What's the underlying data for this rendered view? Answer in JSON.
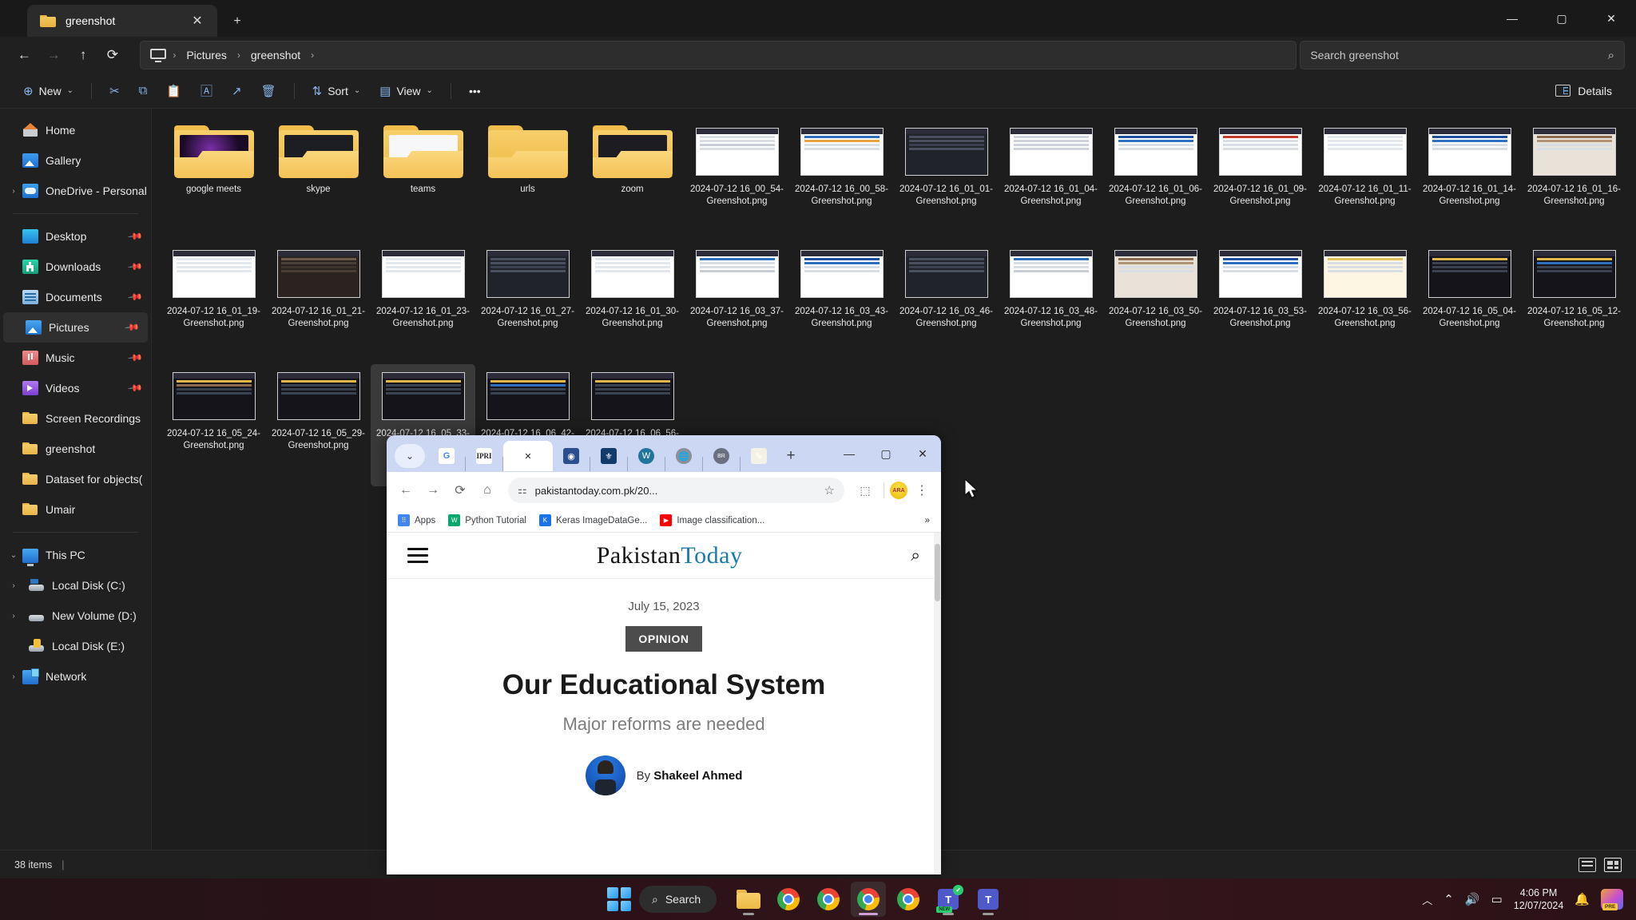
{
  "explorer": {
    "tab": {
      "title": "greenshot",
      "close_label": "✕",
      "new_tab_label": "+"
    },
    "window_controls": {
      "minimize": "—",
      "maximize": "▢",
      "close": "✕"
    },
    "nav": {
      "back": "←",
      "forward": "→",
      "up": "↑",
      "refresh": "⟳"
    },
    "breadcrumb": {
      "items": [
        "Pictures",
        "greenshot"
      ],
      "separator": "›"
    },
    "search": {
      "placeholder": "Search greenshot",
      "icon": "search-icon"
    },
    "commandbar": {
      "new_label": "New",
      "cut_label": "✂",
      "copy_label": "⧉",
      "paste_label": "📋",
      "rename_label": "🄰",
      "share_label": "↗",
      "delete_label": "🗑",
      "sort_label": "Sort",
      "view_label": "View",
      "more_label": "•••",
      "details_label": "Details",
      "chevron": "⌄"
    },
    "sidebar": [
      {
        "label": "Home",
        "icon": "home-icon",
        "expander": "",
        "pinned": false,
        "selected": false,
        "icon_class": "ic-home"
      },
      {
        "label": "Gallery",
        "icon": "gallery-icon",
        "expander": "",
        "pinned": false,
        "selected": false,
        "icon_class": "ic-gallery"
      },
      {
        "label": "OneDrive - Personal",
        "icon": "onedrive-icon",
        "expander": "›",
        "pinned": false,
        "selected": false,
        "icon_class": "ic-onedrive"
      },
      {
        "separator": true
      },
      {
        "label": "Desktop",
        "icon": "desktop-icon",
        "expander": "",
        "pinned": true,
        "selected": false,
        "icon_class": "ic-desktop"
      },
      {
        "label": "Downloads",
        "icon": "downloads-icon",
        "expander": "",
        "pinned": true,
        "selected": false,
        "icon_class": "ic-downloads"
      },
      {
        "label": "Documents",
        "icon": "documents-icon",
        "expander": "",
        "pinned": true,
        "selected": false,
        "icon_class": "ic-documents"
      },
      {
        "label": "Pictures",
        "icon": "pictures-icon",
        "expander": "",
        "pinned": true,
        "selected": true,
        "icon_class": "ic-pictures"
      },
      {
        "label": "Music",
        "icon": "music-icon",
        "expander": "",
        "pinned": true,
        "selected": false,
        "icon_class": "ic-music"
      },
      {
        "label": "Videos",
        "icon": "videos-icon",
        "expander": "",
        "pinned": true,
        "selected": false,
        "icon_class": "ic-videos"
      },
      {
        "label": "Screen Recordings",
        "icon": "folder-icon",
        "expander": "",
        "pinned": false,
        "selected": false,
        "icon_class": "ic-folder"
      },
      {
        "label": "greenshot",
        "icon": "folder-icon",
        "expander": "",
        "pinned": false,
        "selected": false,
        "icon_class": "ic-folder"
      },
      {
        "label": "Dataset for objects(",
        "icon": "folder-icon",
        "expander": "",
        "pinned": false,
        "selected": false,
        "icon_class": "ic-folder"
      },
      {
        "label": "Umair",
        "icon": "folder-icon",
        "expander": "",
        "pinned": false,
        "selected": false,
        "icon_class": "ic-folder"
      },
      {
        "separator": true
      },
      {
        "label": "This PC",
        "icon": "this-pc-icon",
        "expander": "⌄",
        "pinned": false,
        "selected": false,
        "icon_class": "ic-thispc"
      },
      {
        "label": "Local Disk (C:)",
        "icon": "disk-icon",
        "expander": "›",
        "indent": true,
        "pinned": false,
        "selected": false,
        "icon_class": "ic-disk"
      },
      {
        "label": "New Volume (D:)",
        "icon": "disk-icon",
        "expander": "›",
        "indent": true,
        "pinned": false,
        "selected": false,
        "icon_class": "ic-disk2"
      },
      {
        "label": "Local Disk (E:)",
        "icon": "disk-locked-icon",
        "expander": "",
        "indent": true,
        "pinned": false,
        "selected": false,
        "icon_class": "ic-disk3"
      },
      {
        "label": "Network",
        "icon": "network-icon",
        "expander": "›",
        "pinned": false,
        "selected": false,
        "icon_class": "ic-network"
      }
    ],
    "files": [
      {
        "name": "google meets",
        "type": "folder",
        "preview": "dark-purple"
      },
      {
        "name": "skype",
        "type": "folder",
        "preview": "skype"
      },
      {
        "name": "teams",
        "type": "folder",
        "preview": "white-doc"
      },
      {
        "name": "urls",
        "type": "folder",
        "preview": "none"
      },
      {
        "name": "zoom",
        "type": "folder",
        "preview": "dark"
      },
      {
        "name": "2024-07-12 16_00_54-Greenshot.png",
        "type": "png",
        "preview": "doc"
      },
      {
        "name": "2024-07-12 16_00_58-Greenshot.png",
        "type": "png",
        "preview": "list"
      },
      {
        "name": "2024-07-12 16_01_01-Greenshot.png",
        "type": "png",
        "preview": "dark-doc"
      },
      {
        "name": "2024-07-12 16_01_04-Greenshot.png",
        "type": "png",
        "preview": "text"
      },
      {
        "name": "2024-07-12 16_01_06-Greenshot.png",
        "type": "png",
        "preview": "blue-site"
      },
      {
        "name": "2024-07-12 16_01_09-Greenshot.png",
        "type": "png",
        "preview": "article"
      },
      {
        "name": "2024-07-12 16_01_11-Greenshot.png",
        "type": "png",
        "preview": "white-page"
      },
      {
        "name": "2024-07-12 16_01_14-Greenshot.png",
        "type": "png",
        "preview": "blue-site"
      },
      {
        "name": "2024-07-12 16_01_16-Greenshot.png",
        "type": "png",
        "preview": "photo"
      },
      {
        "name": "2024-07-12 16_01_19-Greenshot.png",
        "type": "png",
        "preview": "white-page"
      },
      {
        "name": "2024-07-12 16_01_21-Greenshot.png",
        "type": "png",
        "preview": "dark-photo"
      },
      {
        "name": "2024-07-12 16_01_23-Greenshot.png",
        "type": "png",
        "preview": "white-page"
      },
      {
        "name": "2024-07-12 16_01_27-Greenshot.png",
        "type": "png",
        "preview": "dark-doc"
      },
      {
        "name": "2024-07-12 16_01_30-Greenshot.png",
        "type": "png",
        "preview": "white-page"
      },
      {
        "name": "2024-07-12 16_03_37-Greenshot.png",
        "type": "png",
        "preview": "edu"
      },
      {
        "name": "2024-07-12 16_03_43-Greenshot.png",
        "type": "png",
        "preview": "blue-site"
      },
      {
        "name": "2024-07-12 16_03_46-Greenshot.png",
        "type": "png",
        "preview": "dark-doc"
      },
      {
        "name": "2024-07-12 16_03_48-Greenshot.png",
        "type": "png",
        "preview": "edu"
      },
      {
        "name": "2024-07-12 16_03_50-Greenshot.png",
        "type": "png",
        "preview": "photo"
      },
      {
        "name": "2024-07-12 16_03_53-Greenshot.png",
        "type": "png",
        "preview": "blue-site"
      },
      {
        "name": "2024-07-12 16_03_56-Greenshot.png",
        "type": "png",
        "preview": "yellow-site"
      },
      {
        "name": "2024-07-12 16_05_04-Greenshot.png",
        "type": "png",
        "preview": "dark-ui"
      },
      {
        "name": "2024-07-12 16_05_12-Greenshot.png",
        "type": "png",
        "preview": "dark-ui-blue"
      },
      {
        "name": "2024-07-12 16_05_24-Greenshot.png",
        "type": "png",
        "preview": "dark-ui-photo"
      },
      {
        "name": "2024-07-12 16_05_29-Greenshot.png",
        "type": "png",
        "preview": "dark-ui"
      },
      {
        "name": "2024-07-12 16_05_33-Greenshot.png",
        "type": "png",
        "preview": "dark-ui",
        "highlighted": true
      },
      {
        "name": "2024-07-12 16_06_42-Greenshot.png",
        "type": "png",
        "preview": "dark-ui-blue"
      },
      {
        "name": "2024-07-12 16_06_56-Greenshot.png",
        "type": "png",
        "preview": "dark-ui"
      }
    ],
    "status": {
      "items_count": "38 items",
      "view_list": "list-view-icon",
      "view_tiles": "tiles-view-icon"
    }
  },
  "chrome": {
    "tab_search_icon": "chevron-down-icon",
    "tabs": [
      {
        "icon": "google-icon",
        "label": "G",
        "active": false
      },
      {
        "icon": "ipri-icon",
        "label": "IPRI",
        "active": false
      },
      {
        "icon": "close-icon",
        "label": "✕",
        "active": true
      },
      {
        "icon": "emblem-icon",
        "label": "◉",
        "active": false
      },
      {
        "icon": "university-icon",
        "label": "⚜",
        "active": false
      },
      {
        "icon": "wordpress-icon",
        "label": "W",
        "active": false
      },
      {
        "icon": "globe-icon",
        "label": "🌐",
        "active": false
      },
      {
        "icon": "br-icon",
        "label": "BR",
        "active": false
      },
      {
        "icon": "sketch-icon",
        "label": "✎",
        "active": false
      }
    ],
    "new_tab_label": "+",
    "window_controls": {
      "minimize": "—",
      "maximize": "▢",
      "close": "✕"
    },
    "toolbar": {
      "back": "←",
      "forward": "→",
      "reload": "⟳",
      "home": "⌂",
      "site_settings_icon": "tune-icon",
      "url": "pakistantoday.com.pk/20...",
      "bookmark_star": "☆",
      "extensions_icon": "puzzle-icon",
      "profile_initials": "ARA",
      "menu": "⋮"
    },
    "bookmarks": [
      {
        "label": "Apps",
        "icon": "apps-grid-icon"
      },
      {
        "label": "Python Tutorial",
        "icon": "w3schools-icon"
      },
      {
        "label": "Keras ImageDataGe...",
        "icon": "keras-icon"
      },
      {
        "label": "Image classification...",
        "icon": "youtube-icon"
      }
    ],
    "bookmarks_overflow": "»"
  },
  "webpage": {
    "menu_icon": "hamburger-icon",
    "logo_first": "Pakistan",
    "logo_second": "Today",
    "search_icon": "search-icon",
    "date": "July 15, 2023",
    "category": "OPINION",
    "title": "Our Educational System",
    "subtitle": "Major reforms are needed",
    "by_prefix": "By",
    "author": "Shakeel Ahmed"
  },
  "taskbar": {
    "start_label": "start-icon",
    "search_placeholder": "Search",
    "search_icon": "search-icon",
    "apps": [
      {
        "name": "file-explorer",
        "icon": "folder-icon",
        "running": true,
        "active": false
      },
      {
        "name": "chrome-1",
        "icon": "chrome-icon",
        "running": false,
        "active": false
      },
      {
        "name": "chrome-2",
        "icon": "chrome-icon",
        "running": false,
        "active": false
      },
      {
        "name": "chrome-3",
        "icon": "chrome-icon",
        "running": true,
        "active": true
      },
      {
        "name": "chrome-4",
        "icon": "chrome-icon",
        "running": false,
        "active": false
      },
      {
        "name": "teams-new",
        "icon": "teams-icon",
        "running": true,
        "active": false,
        "badge": "NEW"
      },
      {
        "name": "teams-classic",
        "icon": "teams-icon",
        "running": true,
        "active": false
      }
    ],
    "tray": {
      "chevron_up": "︿",
      "wifi_icon": "wifi-icon",
      "volume_icon": "speaker-icon",
      "battery_icon": "battery-icon",
      "time": "4:06 PM",
      "date": "12/07/2024",
      "notifications_icon": "bell-icon",
      "copilot_icon": "copilot-icon",
      "copilot_badge": "PRE"
    }
  }
}
